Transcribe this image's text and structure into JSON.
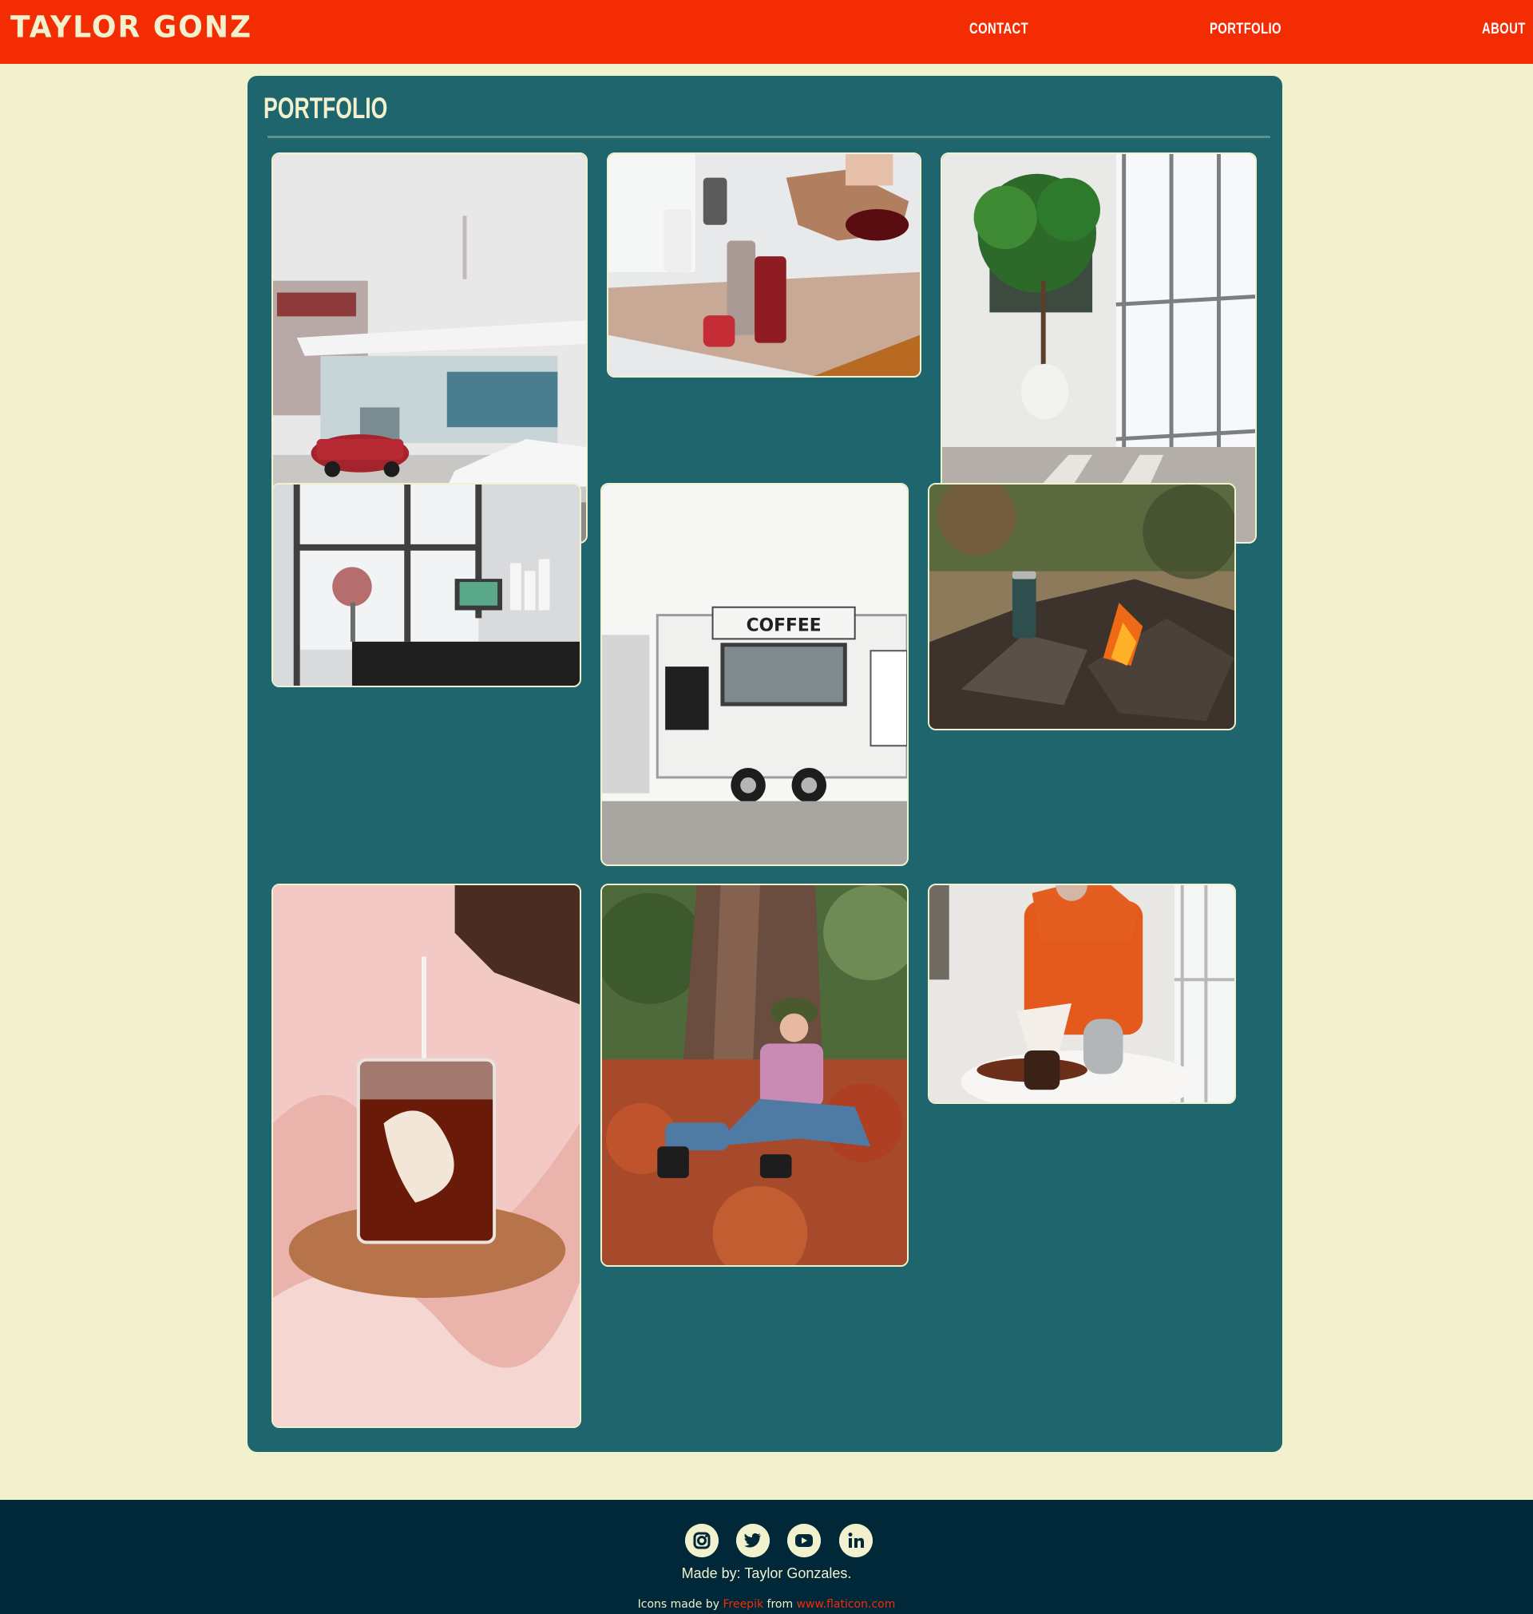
{
  "header": {
    "brand": "TAYLOR GONZ",
    "nav": [
      {
        "label": "CONTACT"
      },
      {
        "label": "PORTFOLIO"
      },
      {
        "label": "ABOUT"
      }
    ]
  },
  "portfolio": {
    "title": "PORTFOLIO"
  },
  "footer": {
    "social_icons": [
      "instagram-icon",
      "twitter-icon",
      "youtube-icon",
      "linkedin-icon"
    ],
    "made_by": "Made by: Taylor Gonzales.",
    "credits_prefix": "Icons made by",
    "credits_author": "Freepik",
    "credits_middle": "from",
    "credits_site": "www.flaticon.com"
  },
  "colors": {
    "header_bg": "#f42c04",
    "page_bg": "#f1f2cd",
    "panel_bg": "#1f656d",
    "footer_bg": "#012839"
  }
}
